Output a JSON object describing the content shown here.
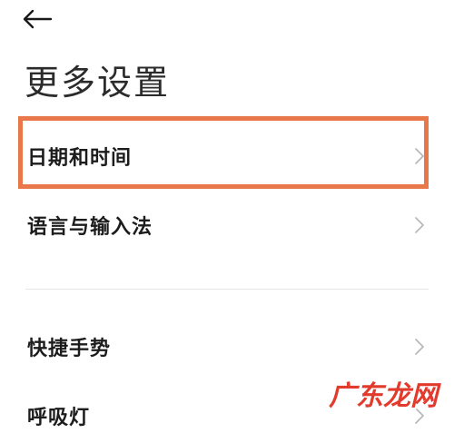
{
  "header": {
    "back_icon": "arrow-left-icon",
    "title": "更多设置"
  },
  "items": [
    {
      "label": "日期和时间",
      "icon": "chevron-right-icon",
      "highlighted": true
    },
    {
      "label": "语言与输入法",
      "icon": "chevron-right-icon"
    },
    {
      "label": "快捷手势",
      "icon": "chevron-right-icon"
    },
    {
      "label": "呼吸灯",
      "icon": "chevron-right-icon"
    }
  ],
  "watermark": {
    "text": "广东龙网"
  },
  "colors": {
    "highlight": "#e8784a",
    "watermark": "#e23b2e"
  }
}
